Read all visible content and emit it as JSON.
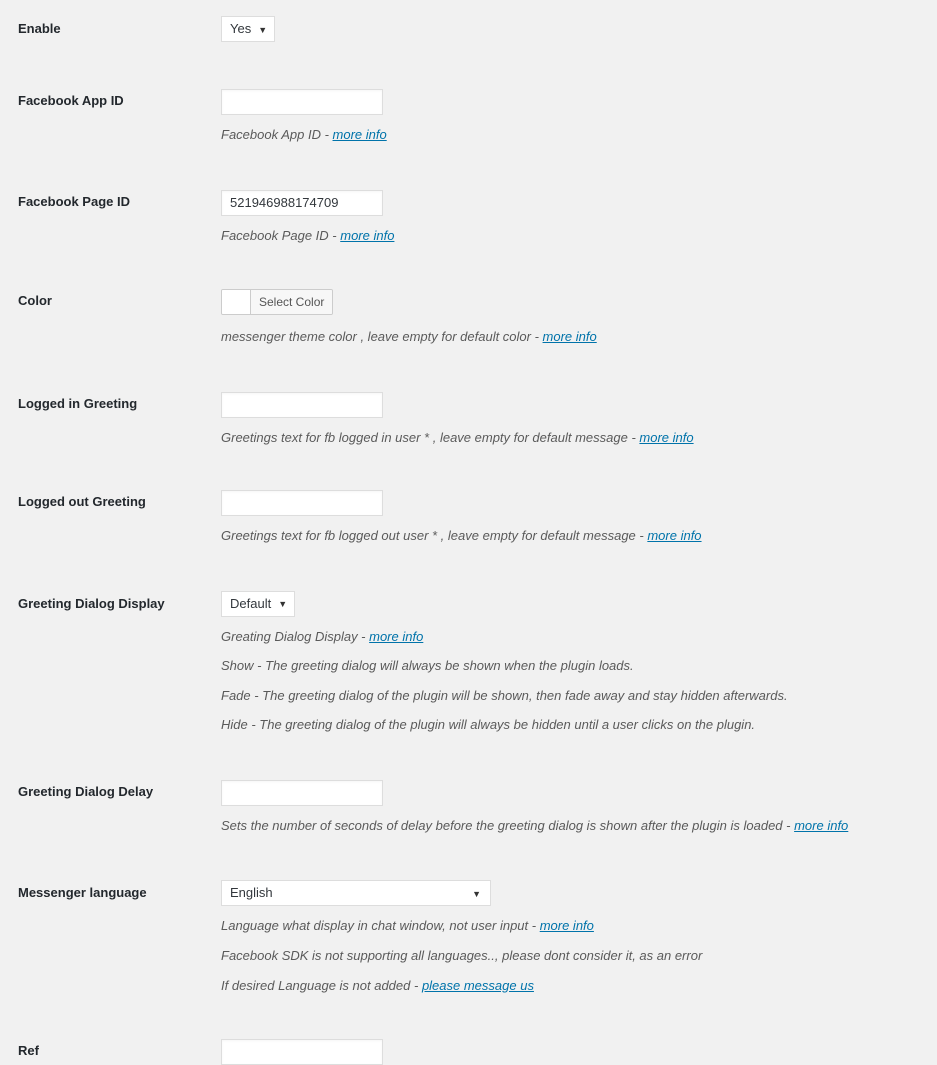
{
  "rows": {
    "enable": {
      "label": "Enable",
      "value": "Yes"
    },
    "app_id": {
      "label": "Facebook App ID",
      "value": "",
      "hint_text": "Facebook App ID - ",
      "hint_link": "more info"
    },
    "page_id": {
      "label": "Facebook Page ID",
      "value": "521946988174709",
      "hint_text": "Facebook Page ID - ",
      "hint_link": "more info"
    },
    "color": {
      "label": "Color",
      "button_label": "Select Color",
      "swatch_color": "#ffffff",
      "hint_text": "messenger theme color , leave empty for default color - ",
      "hint_link": "more info"
    },
    "logged_in_greeting": {
      "label": "Logged in Greeting",
      "value": "",
      "hint_text": "Greetings text for fb logged in user * , leave empty for default message - ",
      "hint_link": "more info"
    },
    "logged_out_greeting": {
      "label": "Logged out Greeting",
      "value": "",
      "hint_text": "Greetings text for fb logged out user * , leave empty for default message - ",
      "hint_link": "more info"
    },
    "greeting_dialog_display": {
      "label": "Greeting Dialog Display",
      "value": "Default",
      "hint_text": "Greating Dialog Display - ",
      "hint_link": "more info",
      "hint_show": "Show - The greeting dialog will always be shown when the plugin loads.",
      "hint_fade": "Fade - The greeting dialog of the plugin will be shown, then fade away and stay hidden afterwards.",
      "hint_hide": "Hide - The greeting dialog of the plugin will always be hidden until a user clicks on the plugin."
    },
    "greeting_dialog_delay": {
      "label": "Greeting Dialog Delay",
      "value": "",
      "hint_text": "Sets the number of seconds of delay before the greeting dialog is shown after the plugin is loaded - ",
      "hint_link": "more info"
    },
    "messenger_language": {
      "label": "Messenger language",
      "value": "English",
      "hint_text": "Language what display in chat window, not user input - ",
      "hint_link": "more info",
      "hint_sdk": "Facebook SDK is not supporting all languages.., please dont consider it, as an error",
      "hint_missing_text": "If desired Language is not added - ",
      "hint_missing_link": "please message us"
    },
    "ref": {
      "label": "Ref",
      "value": ""
    }
  },
  "icons": {
    "dropdown_arrow": "▼"
  },
  "colors": {
    "link": "#0073aa",
    "label": "#23282d",
    "background": "#f1f1f1"
  }
}
